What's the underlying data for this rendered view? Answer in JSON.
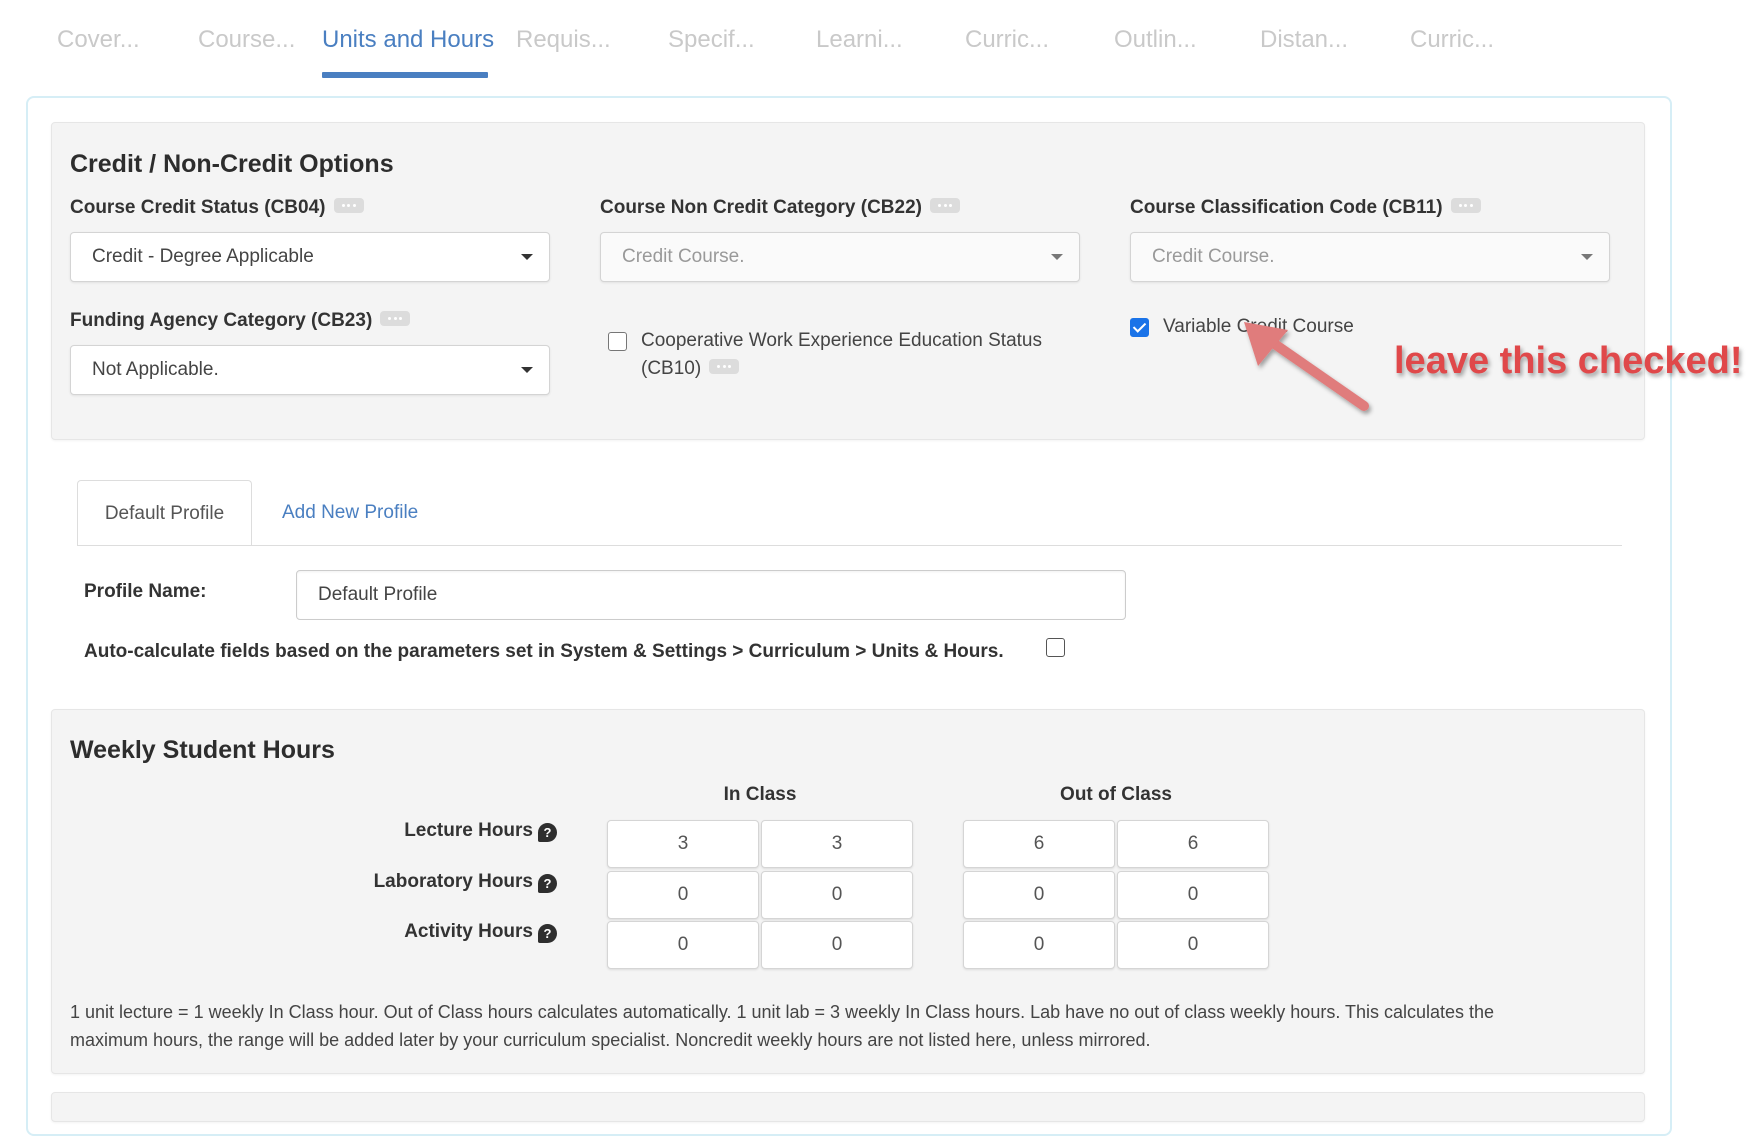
{
  "tabs": [
    {
      "label": "Cover...",
      "active": false
    },
    {
      "label": "Course...",
      "active": false
    },
    {
      "label": "Units and Hours",
      "active": true
    },
    {
      "label": "Requis...",
      "active": false
    },
    {
      "label": "Specif...",
      "active": false
    },
    {
      "label": "Learni...",
      "active": false
    },
    {
      "label": "Curric...",
      "active": false
    },
    {
      "label": "Outlin...",
      "active": false
    },
    {
      "label": "Distan...",
      "active": false
    },
    {
      "label": "Curric...",
      "active": false
    }
  ],
  "colors": {
    "accent": "#4a7fc1",
    "annotation": "#e0484a",
    "checkbox": "#1a73e8"
  },
  "credit": {
    "title": "Credit / Non-Credit Options",
    "credit_status": {
      "label": "Course Credit Status (CB04)",
      "value": "Credit - Degree Applicable"
    },
    "non_credit_category": {
      "label": "Course Non Credit Category (CB22)",
      "value": "Credit Course."
    },
    "classification_code": {
      "label": "Course Classification Code (CB11)",
      "value": "Credit Course."
    },
    "funding_agency": {
      "label": "Funding Agency Category (CB23)",
      "value": "Not Applicable."
    },
    "coop_work": {
      "label_line1": "Cooperative Work Experience Education Status",
      "label_line2": "(CB10)",
      "checked": false
    },
    "variable_credit": {
      "label": "Variable Credit Course",
      "checked": true
    }
  },
  "annotation": {
    "text": "leave this checked!"
  },
  "profiles": {
    "tabs": [
      {
        "label": "Default Profile",
        "active": true
      },
      {
        "label": "Add New Profile",
        "active": false
      }
    ],
    "name_label": "Profile Name:",
    "name_value": "Default Profile",
    "auto_calc_label": "Auto-calculate fields based on the parameters set in System & Settings > Curriculum > Units & Hours.",
    "auto_calc_checked": false
  },
  "weekly": {
    "title": "Weekly Student Hours",
    "columns": [
      "In Class",
      "Out of Class"
    ],
    "rows": [
      {
        "label": "Lecture Hours",
        "in_class": [
          "3",
          "3"
        ],
        "out_of_class": [
          "6",
          "6"
        ]
      },
      {
        "label": "Laboratory Hours",
        "in_class": [
          "0",
          "0"
        ],
        "out_of_class": [
          "0",
          "0"
        ]
      },
      {
        "label": "Activity Hours",
        "in_class": [
          "0",
          "0"
        ],
        "out_of_class": [
          "0",
          "0"
        ]
      }
    ],
    "help_glyph": "?",
    "note": "1 unit lecture = 1 weekly In Class hour. Out of Class hours calculates automatically. 1 unit lab = 3 weekly In Class hours. Lab have no out of class weekly hours. This calculates the maximum hours, the range will be added later by your curriculum specialist. Noncredit weekly hours are not listed here, unless mirrored."
  }
}
